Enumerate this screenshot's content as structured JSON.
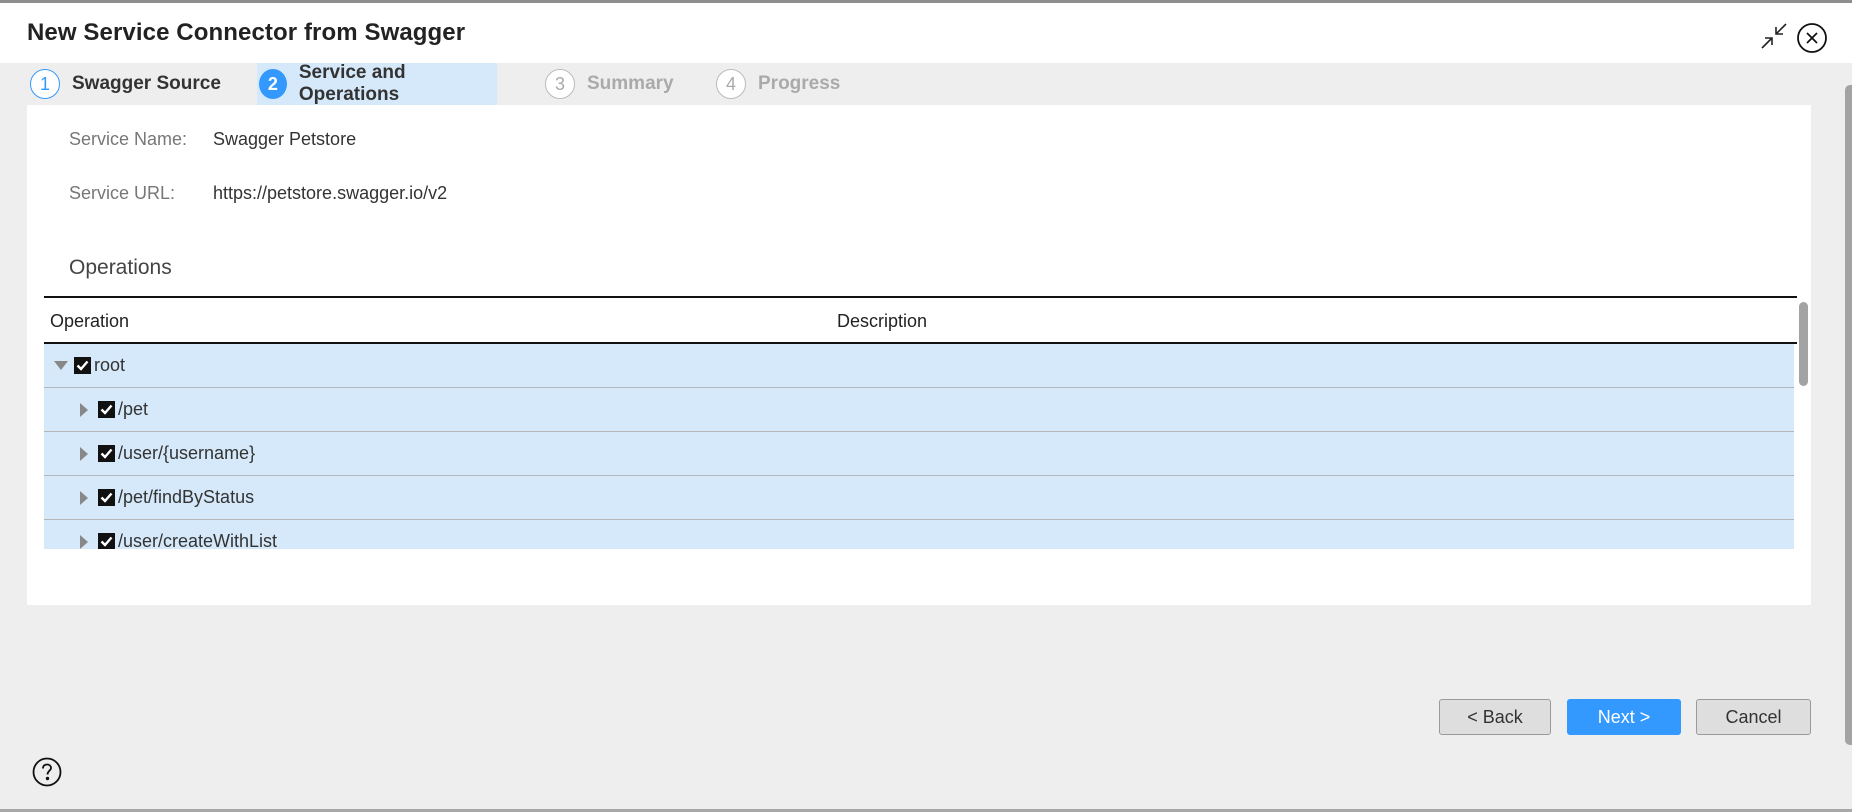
{
  "dialog": {
    "title": "New Service Connector from Swagger",
    "icons": {
      "collapse": "collapse-icon",
      "close": "close-icon",
      "help": "help-icon"
    }
  },
  "steps": [
    {
      "number": "1",
      "label": "Swagger Source",
      "state": "done"
    },
    {
      "number": "2",
      "label": "Service and Operations",
      "state": "active"
    },
    {
      "number": "3",
      "label": "Summary",
      "state": "todo"
    },
    {
      "number": "4",
      "label": "Progress",
      "state": "todo"
    }
  ],
  "service": {
    "name_label": "Service Name:",
    "name_value": "Swagger Petstore",
    "url_label": "Service URL:",
    "url_value": "https://petstore.swagger.io/v2"
  },
  "operations": {
    "section_title": "Operations",
    "columns": [
      "Operation",
      "Description"
    ],
    "rows": [
      {
        "label": "root",
        "level": 0,
        "expanded": true,
        "checked": true,
        "description": ""
      },
      {
        "label": "/pet",
        "level": 1,
        "expanded": false,
        "checked": true,
        "description": ""
      },
      {
        "label": "/user/{username}",
        "level": 1,
        "expanded": false,
        "checked": true,
        "description": ""
      },
      {
        "label": "/pet/findByStatus",
        "level": 1,
        "expanded": false,
        "checked": true,
        "description": ""
      },
      {
        "label": "/user/createWithList",
        "level": 1,
        "expanded": false,
        "checked": true,
        "description": ""
      }
    ]
  },
  "buttons": {
    "back": "< Back",
    "next": "Next >",
    "cancel": "Cancel"
  },
  "colors": {
    "accent": "#3399ff",
    "row_selected": "#d6e9fa",
    "background": "#eeeeee"
  }
}
